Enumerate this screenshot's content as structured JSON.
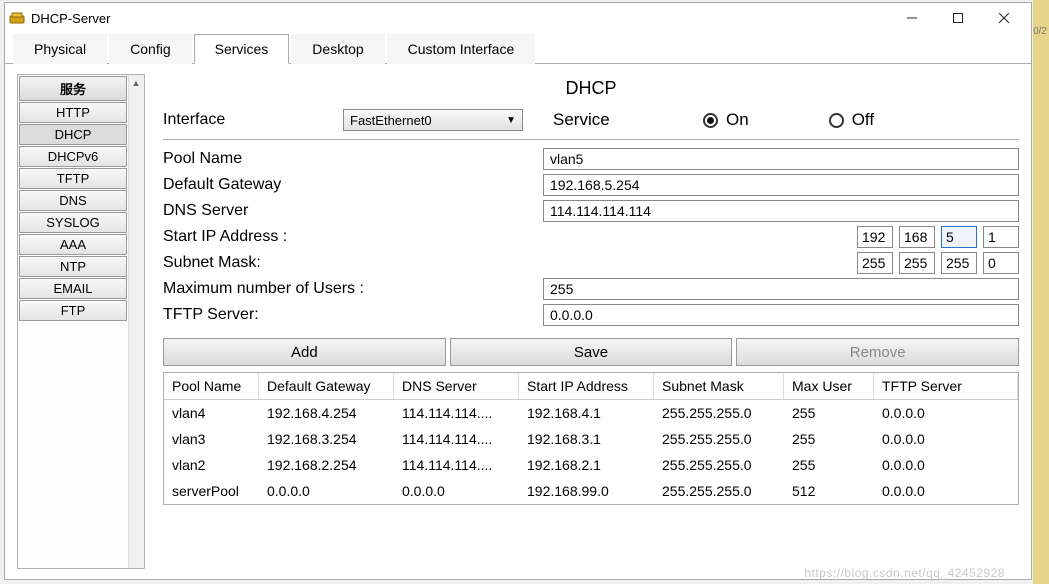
{
  "window": {
    "title": "DHCP-Server"
  },
  "tabs": [
    "Physical",
    "Config",
    "Services",
    "Desktop",
    "Custom Interface"
  ],
  "active_tab_index": 2,
  "sidebar": {
    "header": "服务",
    "items": [
      "HTTP",
      "DHCP",
      "DHCPv6",
      "TFTP",
      "DNS",
      "SYSLOG",
      "AAA",
      "NTP",
      "EMAIL",
      "FTP"
    ],
    "selected_index": 1
  },
  "page": {
    "title": "DHCP",
    "interface_label": "Interface",
    "interface_value": "FastEthernet0",
    "service_label": "Service",
    "radio_on": "On",
    "radio_off": "Off",
    "service_on": true,
    "fields": {
      "pool_name_label": "Pool Name",
      "pool_name_value": "vlan5",
      "gateway_label": "Default Gateway",
      "gateway_value": "192.168.5.254",
      "dns_label": "DNS Server",
      "dns_value": "114.114.114.114",
      "start_ip_label": "Start IP Address :",
      "start_ip": [
        "192",
        "168",
        "5",
        "1"
      ],
      "subnet_label": "Subnet Mask:",
      "subnet": [
        "255",
        "255",
        "255",
        "0"
      ],
      "max_users_label": "Maximum number of Users :",
      "max_users_value": "255",
      "tftp_label": "TFTP Server:",
      "tftp_value": "0.0.0.0"
    },
    "buttons": {
      "add": "Add",
      "save": "Save",
      "remove": "Remove"
    },
    "table": {
      "headers": [
        "Pool Name",
        "Default Gateway",
        "DNS Server",
        "Start IP Address",
        "Subnet Mask",
        "Max User",
        "TFTP Server"
      ],
      "rows": [
        [
          "vlan4",
          "192.168.4.254",
          "114.114.114....",
          "192.168.4.1",
          "255.255.255.0",
          "255",
          "0.0.0.0"
        ],
        [
          "vlan3",
          "192.168.3.254",
          "114.114.114....",
          "192.168.3.1",
          "255.255.255.0",
          "255",
          "0.0.0.0"
        ],
        [
          "vlan2",
          "192.168.2.254",
          "114.114.114....",
          "192.168.2.1",
          "255.255.255.0",
          "255",
          "0.0.0.0"
        ],
        [
          "serverPool",
          "0.0.0.0",
          "0.0.0.0",
          "192.168.99.0",
          "255.255.255.0",
          "512",
          "0.0.0.0"
        ]
      ]
    }
  },
  "watermark": "https://blog.csdn.net/qq_42452928",
  "right_edge_text": "0/2"
}
